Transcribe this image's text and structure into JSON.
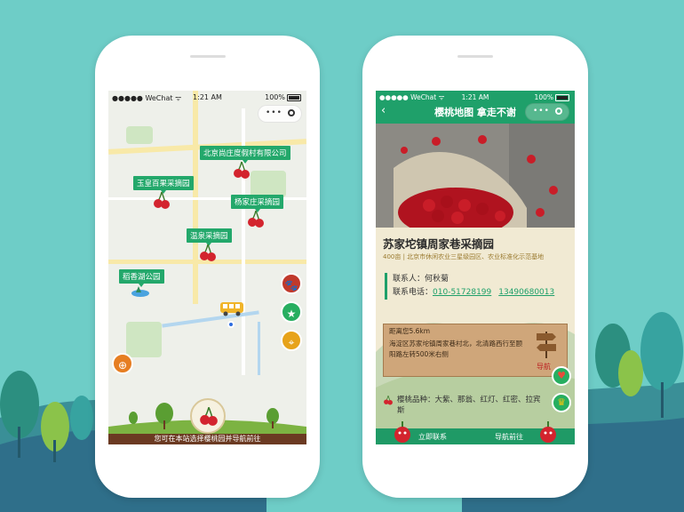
{
  "left_phone": {
    "status": {
      "carrier": "●●●●● WeChat ᯤ",
      "time": "1:21 AM",
      "battery": "100%"
    },
    "capsule": {
      "dots": "•••"
    },
    "map_labels": [
      "北京尚庄度假村有限公司",
      "玉皇百果采摘园",
      "杨家庄采摘园",
      "温泉采摘园",
      "稻香湖公园"
    ],
    "side_buttons": [
      {
        "icon": "paw-icon",
        "glyph": "🐾",
        "color": "#c0392b"
      },
      {
        "icon": "star-icon",
        "glyph": "★",
        "color": "#27ae60"
      },
      {
        "icon": "location-icon",
        "glyph": "⌖",
        "color": "#e7a31a"
      },
      {
        "icon": "locate-me-icon",
        "glyph": "⊕",
        "color": "#e67e22"
      }
    ],
    "bottom_text": "您可在本站选择樱桃园并导航前往"
  },
  "right_phone": {
    "status": {
      "carrier": "●●●●● WeChat ᯤ",
      "time": "1:21 AM",
      "battery": "100%"
    },
    "title": "樱桃地图 拿走不谢",
    "back": "‹",
    "capsule": {
      "dots": "•••"
    },
    "place_name": "苏家坨镇周家巷采摘园",
    "place_sub": "400亩 | 北京市休闲农业三星级园区、农业标准化示范基地",
    "contact_person_label": "联系人：",
    "contact_person": "何秋菊",
    "contact_phone_label": "联系电话：",
    "phone1": "010-51728199",
    "phone2": "13490680013",
    "distance": "距离您5.6km",
    "address": "海淀区苏家坨镇周家巷村北，北清路西行至颐阳路左转500米右侧",
    "nav_label": "导航",
    "variety": "樱桃品种：大紫、那翁、红灯、红密、拉宾斯",
    "footer_left": "立即联系",
    "footer_right": "导航前往"
  },
  "colors": {
    "bg": "#6ecdc7",
    "green": "#1fa06a",
    "brown": "#6b3a22"
  }
}
